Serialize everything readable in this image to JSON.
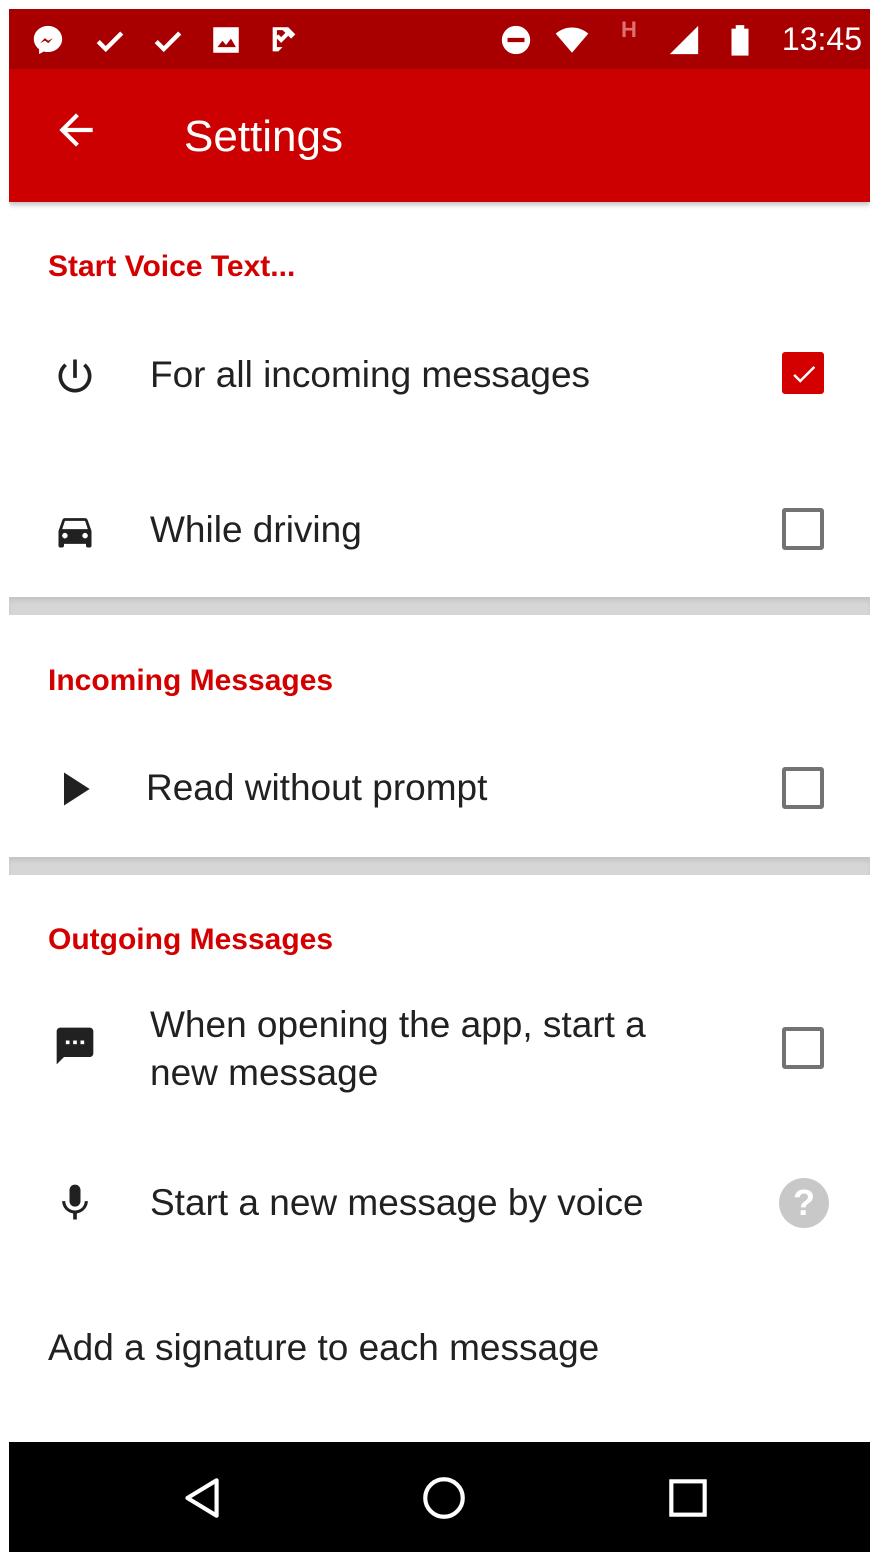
{
  "status_bar": {
    "icons": [
      "messenger-icon",
      "check-icon",
      "check-icon",
      "image-icon",
      "task-icon",
      "do-not-disturb-icon",
      "wifi-icon",
      "signal-icon",
      "battery-icon"
    ],
    "network_type": "H",
    "time": "13:45"
  },
  "app_bar": {
    "back_icon": "arrow-back-icon",
    "title": "Settings"
  },
  "sections": {
    "start_voice": {
      "header": "Start Voice Text...",
      "items": [
        {
          "icon": "power-icon",
          "label": "For all incoming messages",
          "checked": true
        },
        {
          "icon": "car-icon",
          "label": "While driving",
          "checked": false
        }
      ]
    },
    "incoming": {
      "header": "Incoming Messages",
      "items": [
        {
          "icon": "play-icon",
          "label": "Read without prompt",
          "checked": false
        }
      ]
    },
    "outgoing": {
      "header": "Outgoing Messages",
      "items": [
        {
          "icon": "chat-icon",
          "label_line1": "When opening the app, start a",
          "label_line2": "new message",
          "checked": false
        },
        {
          "icon": "microphone-icon",
          "label": "Start a new message by voice",
          "help": "?"
        }
      ],
      "signature_label": "Add a signature to each message"
    }
  },
  "nav_bar": [
    "back-triangle-icon",
    "home-circle-icon",
    "recents-square-icon"
  ],
  "colors": {
    "status_bar": "#a80000",
    "app_bar": "#cc0000",
    "accent": "#d40000",
    "divider": "#d6d6d6"
  }
}
